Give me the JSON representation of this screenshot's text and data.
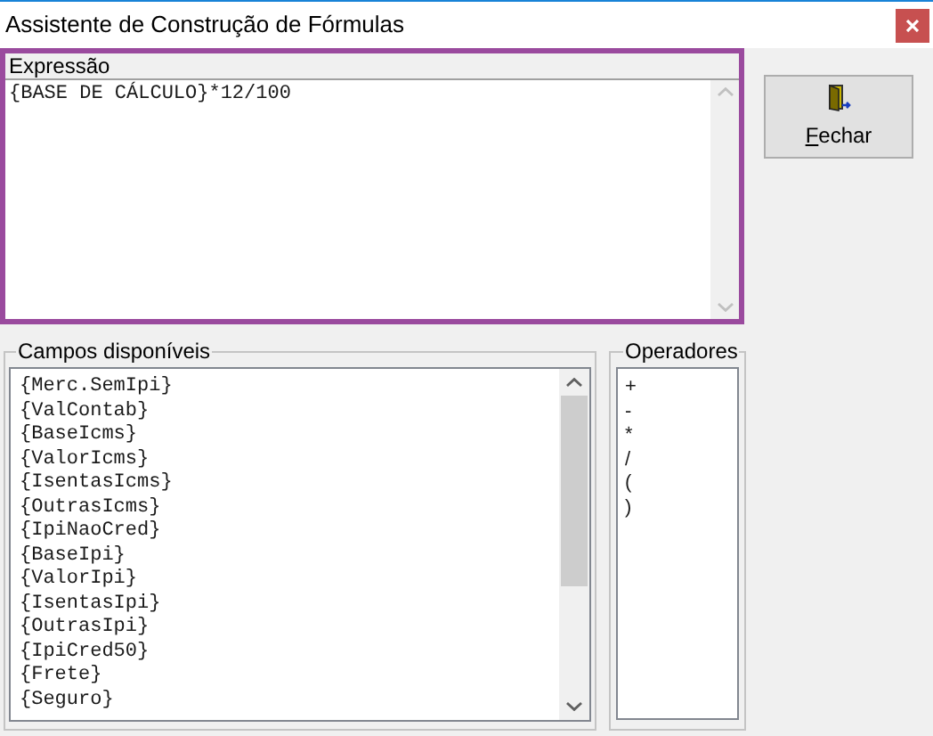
{
  "window": {
    "title": "Assistente de Construção de Fórmulas"
  },
  "expression": {
    "label": "Expressão",
    "value": "{BASE DE CÁLCULO}*12/100"
  },
  "close_button": {
    "mnemonic_letter": "F",
    "label_after_mnemonic": "echar"
  },
  "fields": {
    "title": "Campos disponíveis",
    "items": [
      {
        "label": "{Merc.SemIpi}",
        "selected": false
      },
      {
        "label": "{ValContab}",
        "selected": false
      },
      {
        "label": "{BaseIcms}",
        "selected": false
      },
      {
        "label": "{ValorIcms}",
        "selected": false
      },
      {
        "label": "{IsentasIcms}",
        "selected": false
      },
      {
        "label": "{OutrasIcms}",
        "selected": false
      },
      {
        "label": "{IpiNaoCred}",
        "selected": false
      },
      {
        "label": "{BaseIpi}",
        "selected": false
      },
      {
        "label": "{ValorIpi}",
        "selected": false
      },
      {
        "label": "{IsentasIpi}",
        "selected": false
      },
      {
        "label": "{OutrasIpi}",
        "selected": false
      },
      {
        "label": "{IpiCred50}",
        "selected": false
      },
      {
        "label": "{Frete}",
        "selected": false
      },
      {
        "label": "{Seguro}",
        "selected": false
      }
    ]
  },
  "operators": {
    "title": "Operadores",
    "items": [
      {
        "label": "+",
        "selected": false
      },
      {
        "label": "-",
        "selected": false
      },
      {
        "label": "*",
        "selected": false
      },
      {
        "label": "/",
        "selected": false
      },
      {
        "label": "(",
        "selected": false
      },
      {
        "label": ")",
        "selected": false
      }
    ]
  }
}
